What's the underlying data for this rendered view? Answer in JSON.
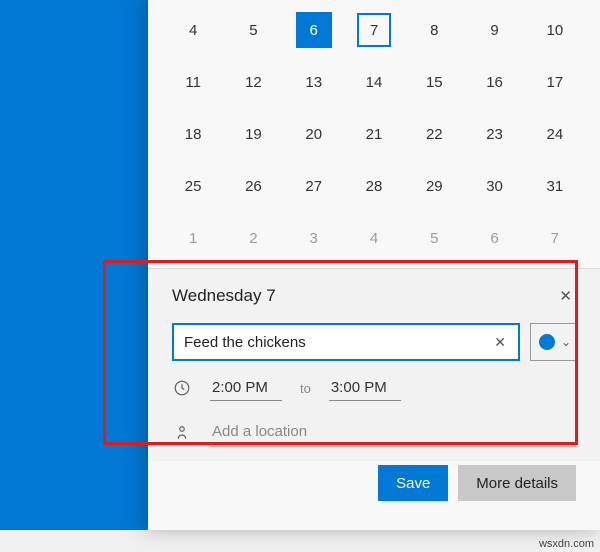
{
  "calendar": {
    "weeks": [
      {
        "days": [
          {
            "n": 4
          },
          {
            "n": 5
          },
          {
            "n": 6,
            "today": true
          },
          {
            "n": 7,
            "selected": true
          },
          {
            "n": 8
          },
          {
            "n": 9
          },
          {
            "n": 10
          }
        ]
      },
      {
        "days": [
          {
            "n": 11
          },
          {
            "n": 12
          },
          {
            "n": 13
          },
          {
            "n": 14
          },
          {
            "n": 15
          },
          {
            "n": 16
          },
          {
            "n": 17
          }
        ]
      },
      {
        "days": [
          {
            "n": 18
          },
          {
            "n": 19
          },
          {
            "n": 20
          },
          {
            "n": 21
          },
          {
            "n": 22
          },
          {
            "n": 23
          },
          {
            "n": 24
          }
        ]
      },
      {
        "days": [
          {
            "n": 25
          },
          {
            "n": 26
          },
          {
            "n": 27
          },
          {
            "n": 28
          },
          {
            "n": 29
          },
          {
            "n": 30
          },
          {
            "n": 31
          }
        ]
      },
      {
        "days": [
          {
            "n": 1,
            "muted": true
          },
          {
            "n": 2,
            "muted": true
          },
          {
            "n": 3,
            "muted": true
          },
          {
            "n": 4,
            "muted": true
          },
          {
            "n": 5,
            "muted": true
          },
          {
            "n": 6,
            "muted": true
          },
          {
            "n": 7,
            "muted": true
          }
        ]
      }
    ]
  },
  "event": {
    "header": "Wednesday 7",
    "close_glyph": "✕",
    "title_value": "Feed the chickens",
    "clear_glyph": "✕",
    "calendar_color": "#0078d4",
    "chevron_glyph": "⌄",
    "start_time": "2:00 PM",
    "to_label": "to",
    "end_time": "3:00 PM",
    "location_placeholder": "Add a location"
  },
  "buttons": {
    "save": "Save",
    "more": "More details"
  },
  "watermark": "wsxdn.com"
}
